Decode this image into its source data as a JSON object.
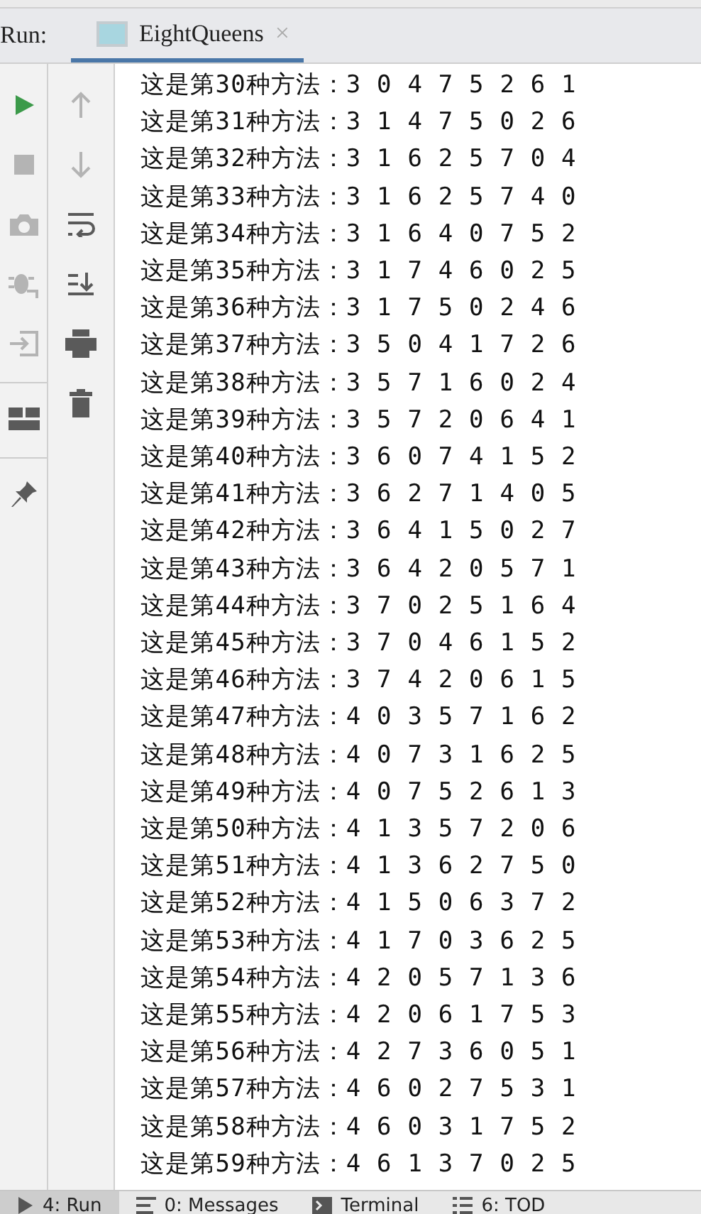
{
  "header": {
    "label": "Run:",
    "tabs": [
      {
        "title": "EightQueens",
        "selected": true,
        "close": "×"
      }
    ]
  },
  "left_toolbar": [
    {
      "kind": "run",
      "disabled": false
    },
    {
      "kind": "stop",
      "disabled": true
    },
    {
      "kind": "camera",
      "disabled": true
    },
    {
      "kind": "debug",
      "disabled": true
    },
    {
      "kind": "enter",
      "disabled": true
    },
    {
      "kind": "layout",
      "disabled": false
    },
    {
      "kind": "pin",
      "disabled": false
    }
  ],
  "console_toolbar": [
    {
      "kind": "up",
      "disabled": true
    },
    {
      "kind": "down",
      "disabled": true
    },
    {
      "kind": "wrap",
      "disabled": false
    },
    {
      "kind": "scroll_end",
      "disabled": false
    },
    {
      "kind": "print",
      "disabled": false
    },
    {
      "kind": "trash",
      "disabled": false
    }
  ],
  "console": {
    "lines": [
      "这是第30种方法：3 0 4 7 5 2 6 1",
      "这是第31种方法：3 1 4 7 5 0 2 6",
      "这是第32种方法：3 1 6 2 5 7 0 4",
      "这是第33种方法：3 1 6 2 5 7 4 0",
      "这是第34种方法：3 1 6 4 0 7 5 2",
      "这是第35种方法：3 1 7 4 6 0 2 5",
      "这是第36种方法：3 1 7 5 0 2 4 6",
      "这是第37种方法：3 5 0 4 1 7 2 6",
      "这是第38种方法：3 5 7 1 6 0 2 4",
      "这是第39种方法：3 5 7 2 0 6 4 1",
      "这是第40种方法：3 6 0 7 4 1 5 2",
      "这是第41种方法：3 6 2 7 1 4 0 5",
      "这是第42种方法：3 6 4 1 5 0 2 7",
      "这是第43种方法：3 6 4 2 0 5 7 1",
      "这是第44种方法：3 7 0 2 5 1 6 4",
      "这是第45种方法：3 7 0 4 6 1 5 2",
      "这是第46种方法：3 7 4 2 0 6 1 5",
      "这是第47种方法：4 0 3 5 7 1 6 2",
      "这是第48种方法：4 0 7 3 1 6 2 5",
      "这是第49种方法：4 0 7 5 2 6 1 3",
      "这是第50种方法：4 1 3 5 7 2 0 6",
      "这是第51种方法：4 1 3 6 2 7 5 0",
      "这是第52种方法：4 1 5 0 6 3 7 2",
      "这是第53种方法：4 1 7 0 3 6 2 5",
      "这是第54种方法：4 2 0 5 7 1 3 6",
      "这是第55种方法：4 2 0 6 1 7 5 3",
      "这是第56种方法：4 2 7 3 6 0 5 1",
      "这是第57种方法：4 6 0 2 7 5 3 1",
      "这是第58种方法：4 6 0 3 1 7 5 2",
      "这是第59种方法：4 6 1 3 7 0 2 5"
    ]
  },
  "bottom_tabs": [
    {
      "kind": "run",
      "label": "4: Run",
      "selected": true
    },
    {
      "kind": "messages",
      "label": "0: Messages",
      "selected": false
    },
    {
      "kind": "terminal",
      "label": "Terminal",
      "selected": false
    },
    {
      "kind": "todo",
      "label": "6: TOD",
      "selected": false
    }
  ]
}
